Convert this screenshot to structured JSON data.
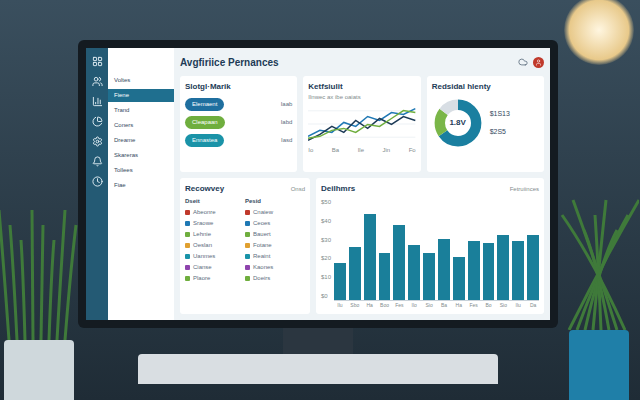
{
  "header": {
    "title": "Avgfiriice Pernances"
  },
  "sidebar": {
    "items": [
      {
        "label": "Voltes",
        "selected": false
      },
      {
        "label": "Fiene",
        "selected": true
      },
      {
        "label": "Trand",
        "selected": false
      },
      {
        "label": "Coners",
        "selected": false
      },
      {
        "label": "Dreame",
        "selected": false
      },
      {
        "label": "Skareras",
        "selected": false
      },
      {
        "label": "Tollees",
        "selected": false
      },
      {
        "label": "Fiae",
        "selected": false
      }
    ]
  },
  "segment_card": {
    "title": "Slotgl·Marik",
    "pills": [
      {
        "label": "Elemaent",
        "value": "Iaab",
        "color": "#1f6f9f"
      },
      {
        "label": "Cleapaan",
        "value": "Iabd",
        "color": "#6fae3e"
      },
      {
        "label": "Ennastea",
        "value": "Iasd",
        "color": "#1a93a8"
      }
    ]
  },
  "line_chart": {
    "title": "Ketfsiulit",
    "subtitle": "Ilnwec ax ibe oaiats",
    "x_labels": [
      "Io",
      "Ba",
      "Ile",
      "Jin",
      "Fo"
    ],
    "series": [
      {
        "color": "#1f78b4",
        "values": [
          20,
          35,
          30,
          55,
          45,
          70,
          60,
          80,
          75,
          90
        ]
      },
      {
        "color": "#1d3b57",
        "values": [
          10,
          25,
          45,
          30,
          60,
          40,
          65,
          50,
          70,
          60
        ]
      },
      {
        "color": "#6fae3e",
        "values": [
          15,
          20,
          35,
          40,
          30,
          50,
          45,
          65,
          85,
          80
        ]
      }
    ]
  },
  "donut": {
    "title": "Redsidal hlenty",
    "center": "1.8V",
    "segments": [
      {
        "value": 65,
        "color": "#1a7fa0"
      },
      {
        "value": 20,
        "color": "#7ab648"
      },
      {
        "value": 15,
        "color": "#d8dee4"
      }
    ],
    "stats": [
      "$1S13",
      "$2S5"
    ]
  },
  "recovery": {
    "title": "Recowvey",
    "action": "Onsd",
    "columns": [
      "Dseit",
      "Pesid"
    ],
    "rows": [
      {
        "cells": [
          "Abeonre",
          "Cnaiew"
        ],
        "color": "#c0392b"
      },
      {
        "cells": [
          "Sraowe",
          "Ceoes"
        ],
        "color": "#1f78b4"
      },
      {
        "cells": [
          "Lehnie",
          "Bauert"
        ],
        "color": "#6fae3e"
      },
      {
        "cells": [
          "Oeslan",
          "Fotane"
        ],
        "color": "#e0a030"
      },
      {
        "cells": [
          "Uanmes",
          "Reaint"
        ],
        "color": "#1a93a8"
      },
      {
        "cells": [
          "Cianse",
          "Kaones"
        ],
        "color": "#8e44ad"
      },
      {
        "cells": [
          "Plaore",
          "Doeirs"
        ],
        "color": "#6fae3e"
      }
    ]
  },
  "bar_chart": {
    "title": "Deilhmrs",
    "legend": "Fetruiinces",
    "ticks": [
      "$50",
      "$40",
      "$30",
      "$20",
      "$10",
      "$0"
    ],
    "x_labels": [
      "Ilu",
      "Sbo",
      "Ha",
      "Boo",
      "Fes",
      "Ilo",
      "Sio",
      "Ba",
      "Ha",
      "Fes",
      "Bo",
      "Sio",
      "Ilu",
      "Da"
    ],
    "values": [
      18,
      26,
      42,
      23,
      37,
      27,
      23,
      30,
      21,
      29,
      28,
      32,
      29,
      32
    ]
  }
}
